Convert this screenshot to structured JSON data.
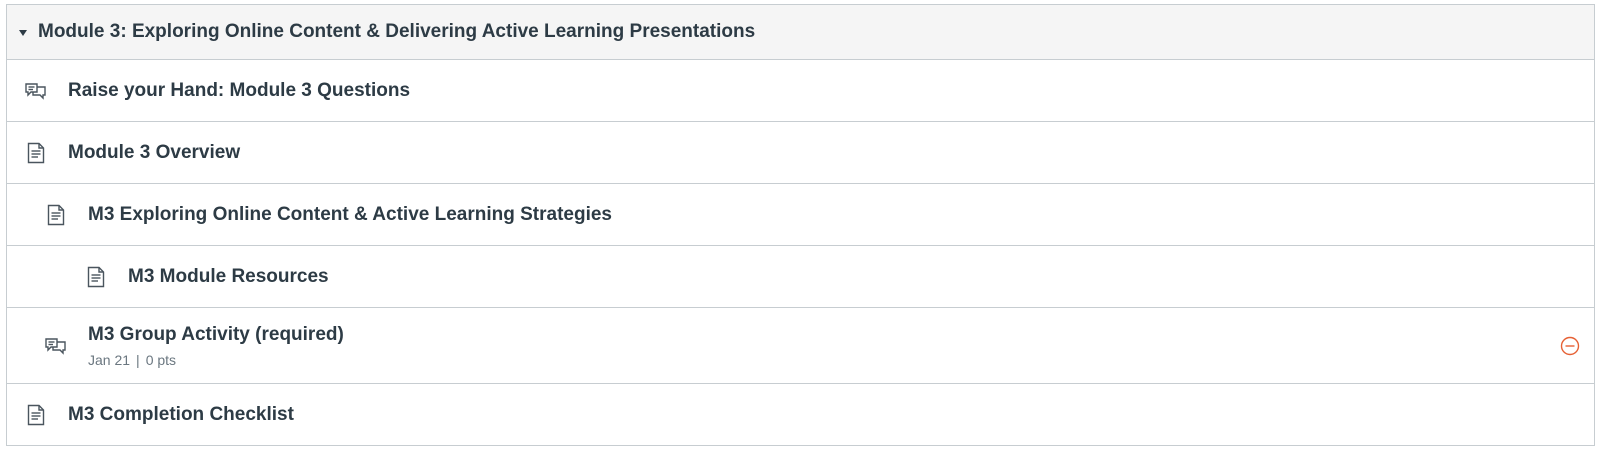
{
  "module": {
    "title": "Module 3: Exploring Online Content & Delivering Active Learning Presentations",
    "items": [
      {
        "title": "Raise your Hand: Module 3 Questions",
        "icon": "discussion-icon"
      },
      {
        "title": "Module 3 Overview",
        "icon": "page-icon"
      },
      {
        "title": "M3 Exploring Online Content & Active Learning Strategies",
        "icon": "page-icon"
      },
      {
        "title": "M3 Module Resources",
        "icon": "page-icon"
      },
      {
        "title": "M3 Group Activity (required)",
        "icon": "discussion-icon",
        "due": "Jan 21",
        "separator": "|",
        "points": "0 pts",
        "status_icon": "minus-circle-icon",
        "status_color": "#e66135"
      },
      {
        "title": "M3 Completion Checklist",
        "icon": "page-icon"
      }
    ]
  }
}
